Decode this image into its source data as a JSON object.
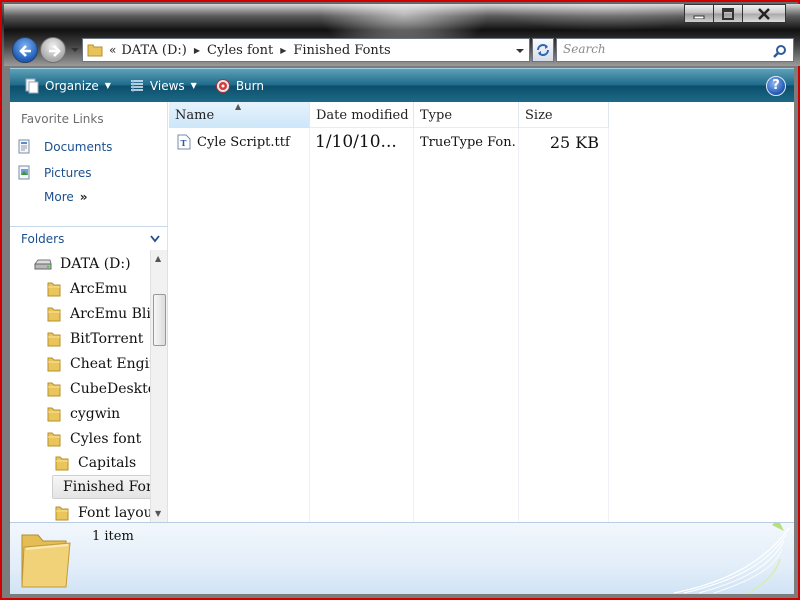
{
  "window": {
    "caption_buttons": [
      "minimize",
      "maximize",
      "close"
    ]
  },
  "address": {
    "chevrons": "«",
    "crumbs": [
      "DATA (D:)",
      "Cyles font",
      "Finished Fonts"
    ]
  },
  "search": {
    "placeholder": "Search"
  },
  "toolbar": {
    "organize_label": "Organize",
    "views_label": "Views",
    "burn_label": "Burn",
    "help_label": "?"
  },
  "nav_pane": {
    "favorites_title": "Favorite Links",
    "links": [
      {
        "label": "Documents",
        "icon": "documents-icon"
      },
      {
        "label": "Pictures",
        "icon": "pictures-icon"
      },
      {
        "label": "More",
        "icon": "double-chevron-right-icon"
      }
    ],
    "folders_title": "Folders",
    "tree": [
      {
        "label": "DATA (D:)",
        "icon": "drive-icon",
        "level": 0
      },
      {
        "label": "ArcEmu",
        "icon": "folder-icon",
        "level": 1
      },
      {
        "label": "ArcEmu Blizz",
        "icon": "folder-icon",
        "level": 1
      },
      {
        "label": "BitTorrent",
        "icon": "folder-icon",
        "level": 1
      },
      {
        "label": "Cheat Engine",
        "icon": "folder-icon",
        "level": 1
      },
      {
        "label": "CubeDesktop",
        "icon": "folder-icon",
        "level": 1
      },
      {
        "label": "cygwin",
        "icon": "folder-icon",
        "level": 1
      },
      {
        "label": "Cyles font",
        "icon": "folder-icon",
        "level": 1
      },
      {
        "label": "Capitals",
        "icon": "folder-icon",
        "level": 2
      },
      {
        "label": "Finished Fonts",
        "icon": "folder-icon",
        "level": 2,
        "selected": true
      },
      {
        "label": "Font layouts",
        "icon": "folder-icon",
        "level": 2
      }
    ]
  },
  "file_list": {
    "columns": [
      "Name",
      "Date modified",
      "Type",
      "Size"
    ],
    "sorted_column": "Name",
    "rows": [
      {
        "name": "Cyle Script.ttf",
        "date_modified": "1/10/10...",
        "type": "TrueType Fon...",
        "size": "25 KB",
        "icon": "truetype-font-file-icon"
      }
    ]
  },
  "details": {
    "item_count": "1 item"
  },
  "colors": {
    "toolbar": "#1f6b8a",
    "link": "#1b4f8f",
    "frame": "#d00000"
  }
}
